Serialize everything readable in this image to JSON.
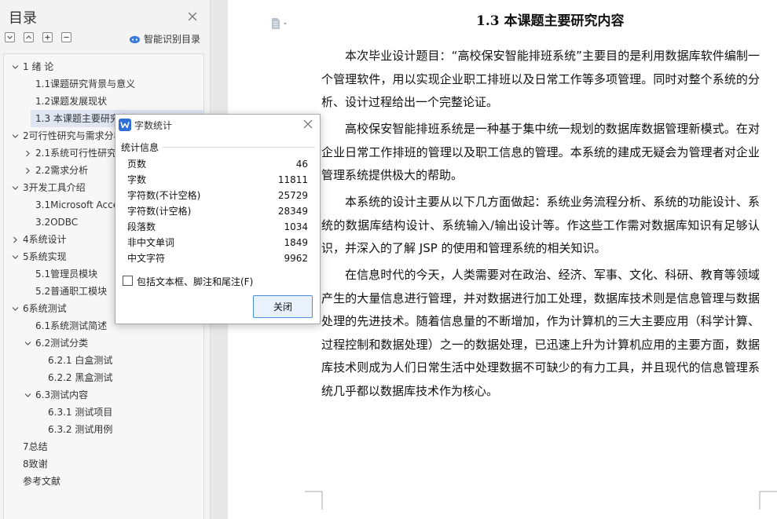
{
  "sidebar": {
    "title": "目录",
    "smart_label": "智能识别目录",
    "toc": [
      {
        "label": "1 绪 论",
        "level": 0,
        "arrow": "expanded"
      },
      {
        "label": "1.1课题研究背景与意义",
        "level": 1,
        "arrow": "none"
      },
      {
        "label": "1.2课题发展现状",
        "level": 1,
        "arrow": "none"
      },
      {
        "label": "1.3 本课题主要研究内容",
        "level": 1,
        "arrow": "none",
        "selected": true
      },
      {
        "label": "2可行性研究与需求分析",
        "level": 0,
        "arrow": "expanded"
      },
      {
        "label": "2.1系统可行性研究",
        "level": 1,
        "arrow": "collapsed"
      },
      {
        "label": "2.2需求分析",
        "level": 1,
        "arrow": "collapsed"
      },
      {
        "label": "3开发工具介绍",
        "level": 0,
        "arrow": "expanded"
      },
      {
        "label": "3.1Microsoft Access",
        "level": 1,
        "arrow": "none"
      },
      {
        "label": "3.2ODBC",
        "level": 1,
        "arrow": "none"
      },
      {
        "label": "4系统设计",
        "level": 0,
        "arrow": "collapsed"
      },
      {
        "label": "5系统实现",
        "level": 0,
        "arrow": "expanded"
      },
      {
        "label": "5.1管理员模块",
        "level": 1,
        "arrow": "none"
      },
      {
        "label": "5.2普通职工模块",
        "level": 1,
        "arrow": "none"
      },
      {
        "label": "6系统测试",
        "level": 0,
        "arrow": "expanded"
      },
      {
        "label": "6.1系统测试简述",
        "level": 1,
        "arrow": "none"
      },
      {
        "label": "6.2测试分类",
        "level": 1,
        "arrow": "expanded"
      },
      {
        "label": "6.2.1 白盒测试",
        "level": 2,
        "arrow": "none"
      },
      {
        "label": "6.2.2 黑盒测试",
        "level": 2,
        "arrow": "none"
      },
      {
        "label": "6.3测试内容",
        "level": 1,
        "arrow": "expanded"
      },
      {
        "label": "6.3.1 测试项目",
        "level": 2,
        "arrow": "none"
      },
      {
        "label": "6.3.2 测试用例",
        "level": 2,
        "arrow": "none"
      },
      {
        "label": "7总结",
        "level": 0,
        "arrow": "none"
      },
      {
        "label": "8致谢",
        "level": 0,
        "arrow": "none"
      },
      {
        "label": "参考文献",
        "level": 0,
        "arrow": "none"
      }
    ]
  },
  "document": {
    "title": "1.3  本课题主要研究内容",
    "paragraphs": [
      "本次毕业设计题目：“高校保安智能排班系统”主要目的是利用数据库软件编制一个管理软件，用以实现企业职工排班以及日常工作等多项管理。同时对整个系统的分析、设计过程给出一个完整论证。",
      "高校保安智能排班系统是一种基于集中统一规划的数据库数据管理新模式。在对企业日常工作排班的管理以及职工信息的管理。本系统的建成无疑会为管理者对企业管理系统提供极大的帮助。",
      "本系统的设计主要从以下几方面做起：系统业务流程分析、系统的功能设计、系统的数据库结构设计、系统输入/输出设计等。作这些工作需对数据库知识有足够认识，并深入的了解 JSP 的使用和管理系统的相关知识。",
      "在信息时代的今天，人类需要对在政治、经济、军事、文化、科研、教育等领域产生的大量信息进行管理，并对数据进行加工处理，数据库技术则是信息管理与数据处理的先进技术。随着信息量的不断增加，作为计算机的三大主要应用（科学计算、过程控制和数据处理）之一的数据处理，已迅速上升为计算机应用的主要方面，数据库技术则成为人们日常生活中处理数据不可缺少的有力工具，并且现代的信息管理系统几乎都以数据库技术作为核心。"
    ]
  },
  "dialog": {
    "title": "字数统计",
    "section": "统计信息",
    "stats": [
      {
        "label": "页数",
        "value": "46"
      },
      {
        "label": "字数",
        "value": "11811"
      },
      {
        "label": "字符数(不计空格)",
        "value": "25729"
      },
      {
        "label": "字符数(计空格)",
        "value": "28349"
      },
      {
        "label": "段落数",
        "value": "1034"
      },
      {
        "label": "非中文单词",
        "value": "1849"
      },
      {
        "label": "中文字符",
        "value": "9962"
      }
    ],
    "checkbox_label": "包括文本框、脚注和尾注(F)",
    "checkbox_checked": false,
    "close_label": "关闭"
  },
  "colors": {
    "accent": "#4a90e2",
    "selected_row": "#dfe6f2",
    "app_icon": "#2f6fd6"
  },
  "icons": {
    "sidebar_close": "close-icon",
    "collapse_all": "collapse-icon",
    "expand_all": "expand-icon",
    "add_level": "plus-icon",
    "remove_level": "minus-icon",
    "smart_toc": "cloud-icon",
    "doc_view": "document-icon",
    "dialog_app": "wps-writer-icon",
    "dialog_close": "close-icon"
  }
}
